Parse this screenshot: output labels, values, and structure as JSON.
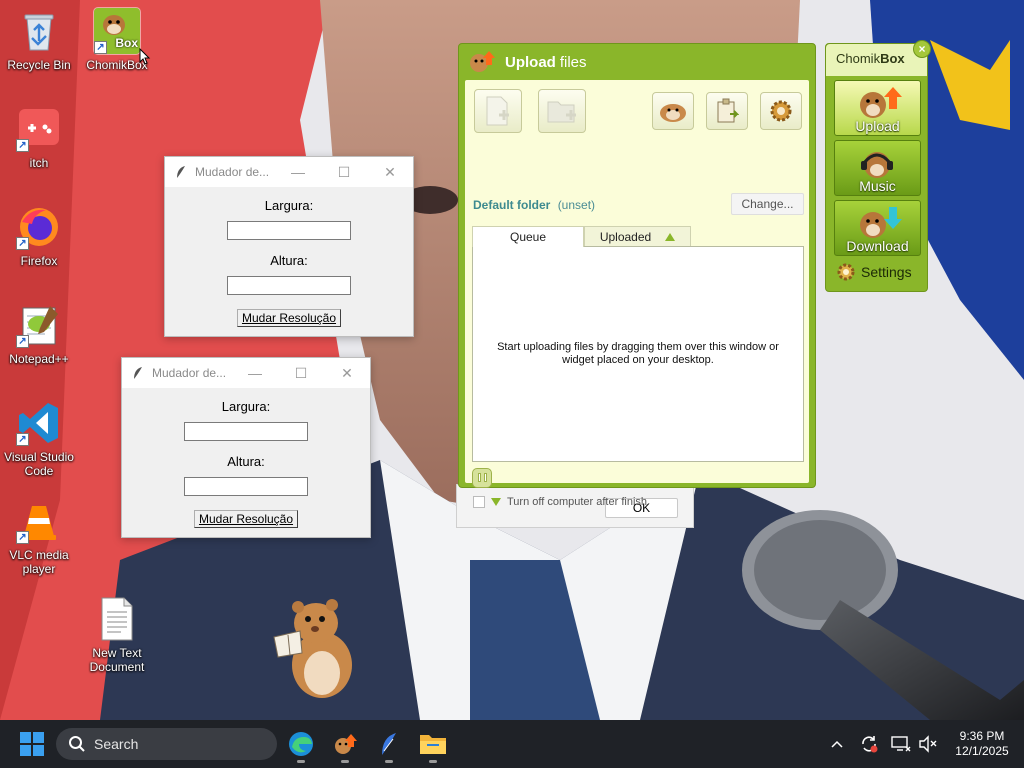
{
  "desktop": {
    "icons": [
      {
        "label": "Recycle Bin"
      },
      {
        "label": "ChomikBox"
      },
      {
        "label": "itch"
      },
      {
        "label": "Firefox"
      },
      {
        "label": "Notepad++"
      },
      {
        "label": "Visual Studio Code"
      },
      {
        "label": "VLC media player"
      },
      {
        "label": "New Text Document"
      }
    ],
    "chomik_icon_text": "Box"
  },
  "tk_windows": [
    {
      "title": "Mudador de...",
      "width_label": "Largura:",
      "height_label": "Altura:",
      "button_label": "Mudar Resolução"
    },
    {
      "title": "Mudador de...",
      "width_label": "Largura:",
      "height_label": "Altura:",
      "button_label": "Mudar Resolução"
    }
  ],
  "upload_dialog": {
    "title_bold": "Upload",
    "title_rest": "files",
    "default_folder_label": "Default folder",
    "default_folder_value": "(unset)",
    "change_button": "Change...",
    "tabs": [
      {
        "label": "Queue",
        "active": true
      },
      {
        "label": "Uploaded",
        "active": false
      }
    ],
    "empty_message": "Start uploading files by dragging them over this window or widget placed on your desktop.",
    "shutdown_label": "Turn off computer after finish",
    "ok_button": "OK",
    "accent_color": "#8ab62a"
  },
  "widget": {
    "title_regular": "Chomik",
    "title_bold": "Box",
    "buttons": [
      {
        "label": "Upload"
      },
      {
        "label": "Music"
      },
      {
        "label": "Download"
      }
    ],
    "settings_label": "Settings"
  },
  "taskbar": {
    "search_placeholder": "Search",
    "time": "9:36 PM",
    "date": "12/1/2025"
  }
}
